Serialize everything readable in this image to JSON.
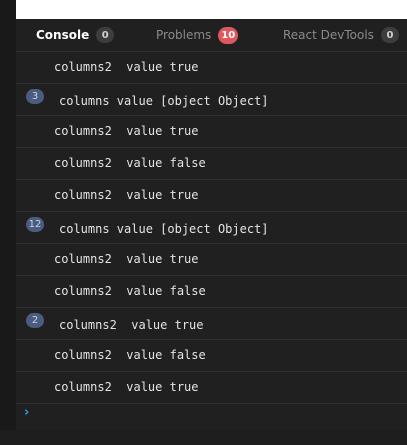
{
  "tabs": [
    {
      "label": "Console",
      "count": "0",
      "active": true
    },
    {
      "label": "Problems",
      "count": "10",
      "active": false
    },
    {
      "label": "React DevTools",
      "count": "0",
      "active": false
    }
  ],
  "logs": [
    {
      "text": "columns2  value true",
      "repeat": ""
    },
    {
      "text": "columns value [object Object]",
      "repeat": "3"
    },
    {
      "text": "columns2  value true",
      "repeat": ""
    },
    {
      "text": "columns2  value false",
      "repeat": ""
    },
    {
      "text": "columns2  value true",
      "repeat": ""
    },
    {
      "text": "columns value [object Object]",
      "repeat": "12"
    },
    {
      "text": "columns2  value true",
      "repeat": ""
    },
    {
      "text": "columns2  value false",
      "repeat": ""
    },
    {
      "text": "columns2  value true",
      "repeat": "2"
    },
    {
      "text": "columns2  value false",
      "repeat": ""
    },
    {
      "text": "columns2  value true",
      "repeat": ""
    }
  ],
  "console_input": {
    "prompt": "›"
  },
  "colors": {
    "alert_badge": "#e0585e",
    "repeat_badge": "#4a5d80",
    "prompt": "#3a9bdc"
  }
}
